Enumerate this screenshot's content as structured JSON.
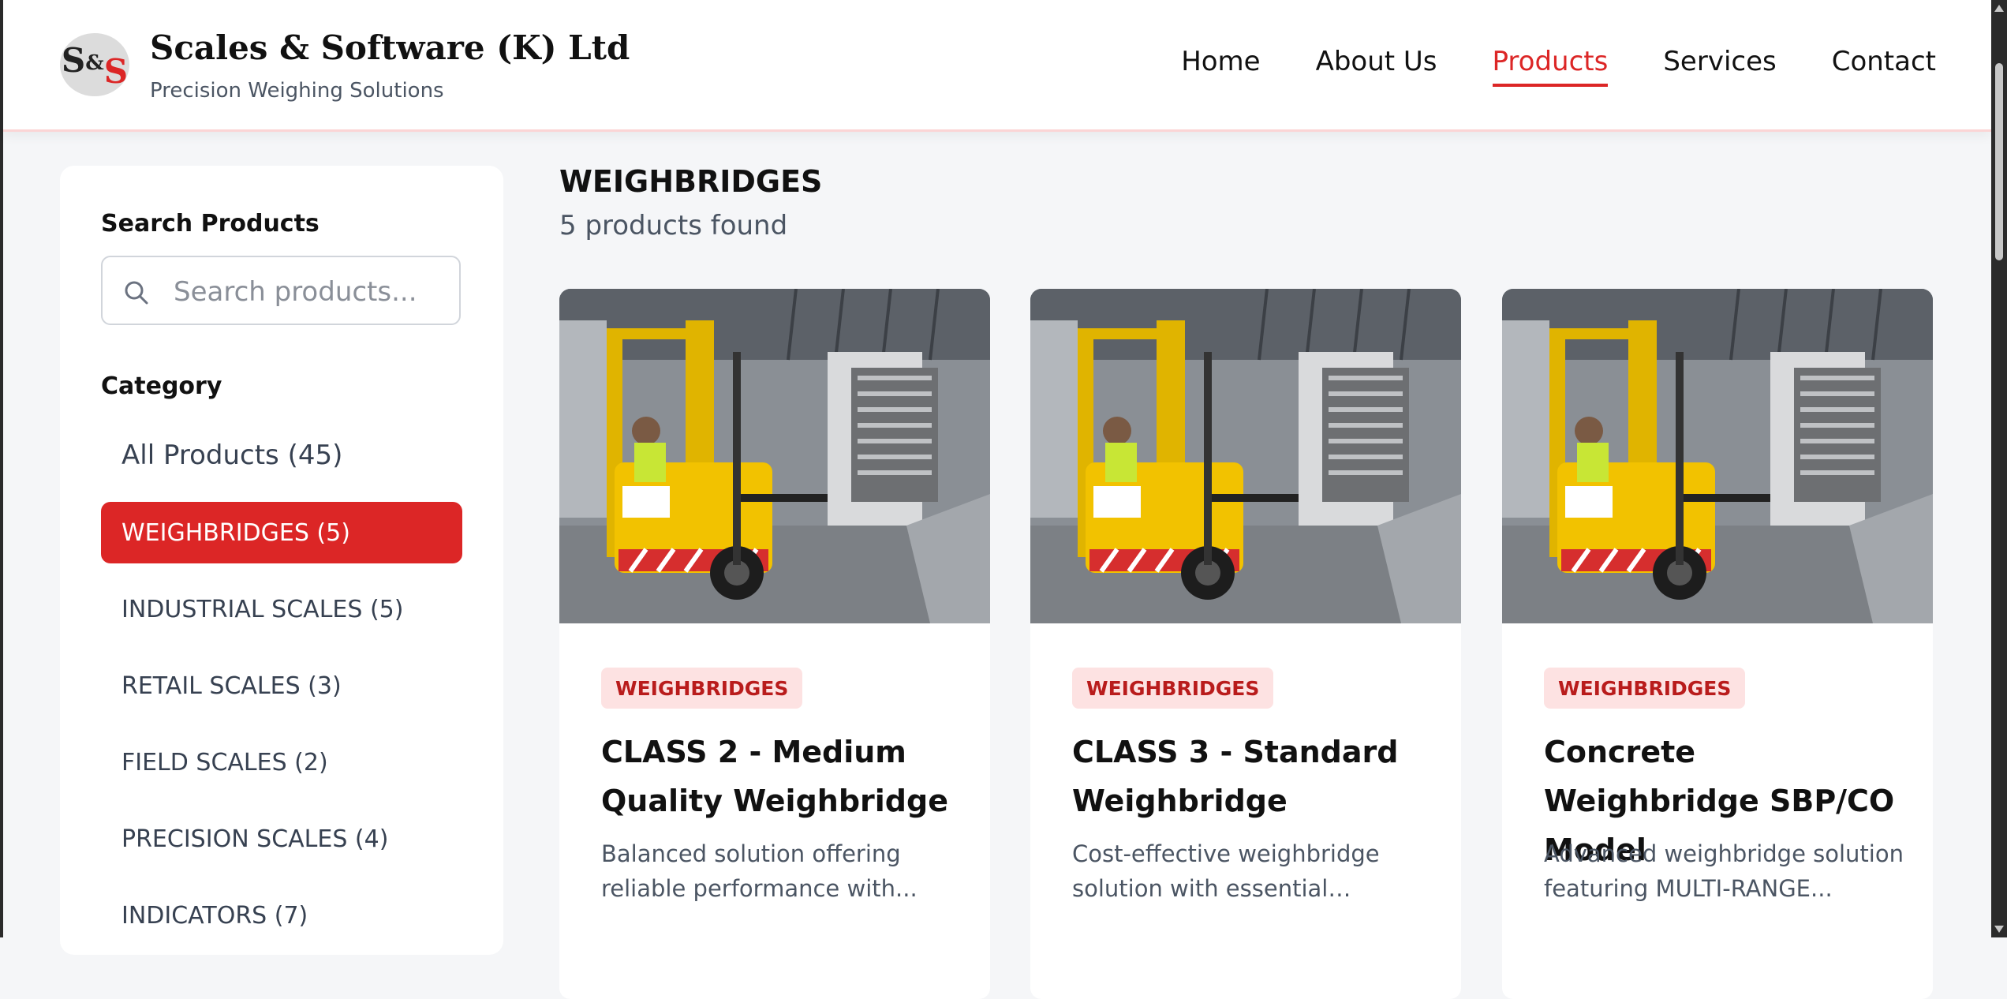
{
  "brand": {
    "name": "Scales & Software (K) Ltd",
    "tagline": "Precision Weighing Solutions",
    "logo_letters": [
      "S",
      "&",
      "S"
    ]
  },
  "nav": {
    "items": [
      {
        "label": "Home",
        "active": false
      },
      {
        "label": "About Us",
        "active": false
      },
      {
        "label": "Products",
        "active": true
      },
      {
        "label": "Services",
        "active": false
      },
      {
        "label": "Contact",
        "active": false
      }
    ]
  },
  "sidebar": {
    "search_heading": "Search Products",
    "search_placeholder": "Search products...",
    "search_value": "",
    "category_heading": "Category",
    "categories": [
      {
        "label": "All Products (45)",
        "active": false
      },
      {
        "label": "WEIGHBRIDGES (5)",
        "active": true
      },
      {
        "label": "INDUSTRIAL SCALES (5)",
        "active": false
      },
      {
        "label": "RETAIL SCALES (3)",
        "active": false
      },
      {
        "label": "FIELD SCALES (2)",
        "active": false
      },
      {
        "label": "PRECISION SCALES (4)",
        "active": false
      },
      {
        "label": "INDICATORS (7)",
        "active": false
      }
    ]
  },
  "main": {
    "title": "WEIGHBRIDGES",
    "count": "5 products found",
    "products": [
      {
        "badge": "WEIGHBRIDGES",
        "title": "CLASS 2 - Medium Quality Weighbridge",
        "description": "Balanced solution offering reliable performance with..."
      },
      {
        "badge": "WEIGHBRIDGES",
        "title": "CLASS 3 - Standard Weighbridge",
        "description": "Cost-effective weighbridge solution with essential feature..."
      },
      {
        "badge": "WEIGHBRIDGES",
        "title": "Concrete Weighbridge SBP/CO Model",
        "description": "Advanced weighbridge solution featuring MULTI-RANGE..."
      }
    ]
  },
  "colors": {
    "accent": "#dc2626",
    "badge_bg": "#fde2e2",
    "page_bg": "#f5f6f8"
  }
}
